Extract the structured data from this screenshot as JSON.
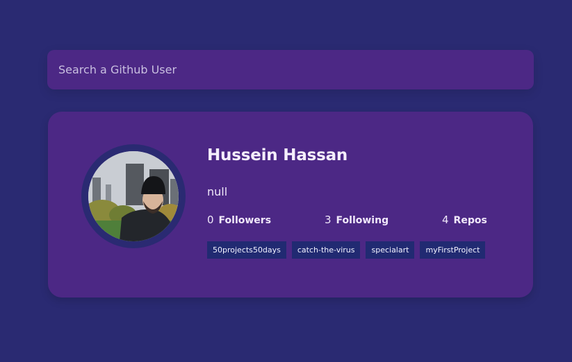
{
  "search": {
    "placeholder": "Search a Github User",
    "value": ""
  },
  "profile": {
    "name": "Hussein Hassan",
    "bio": "null",
    "avatar_alt": "user-avatar-photo",
    "stats": {
      "followers_count": "0",
      "followers_label": "Followers",
      "following_count": "3",
      "following_label": "Following",
      "repos_count": "4",
      "repos_label": "Repos"
    },
    "repos": [
      "50projects50days",
      "catch-the-virus",
      "specialart",
      "myFirstProject"
    ]
  },
  "colors": {
    "background": "#2a2a72",
    "card": "#4c2885",
    "repo_tag": "#212a72",
    "text": "#f5eefc"
  }
}
